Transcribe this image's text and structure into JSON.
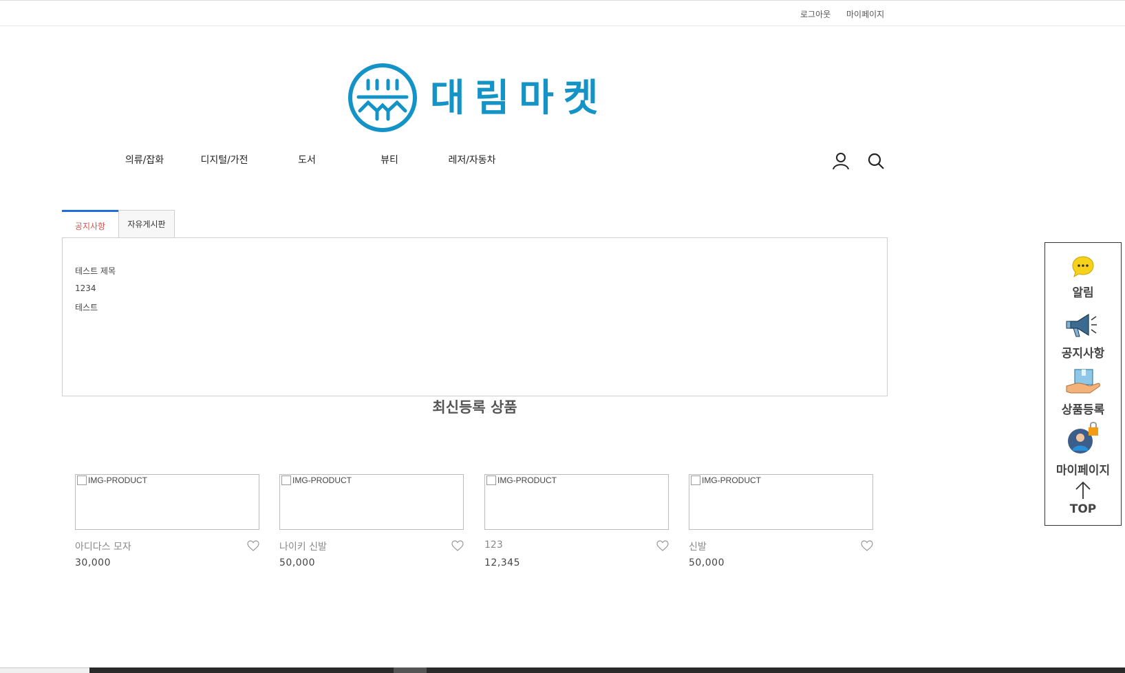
{
  "topbar": {
    "logout": "로그아웃",
    "mypage": "마이페이지"
  },
  "logo": {
    "text": "대림마켓",
    "color": "#1493c7"
  },
  "gnb": [
    "의류/잡화",
    "디지털/가전",
    "도서",
    "뷰티",
    "레저/자동차"
  ],
  "icons": {
    "user": "user-icon",
    "search": "search-icon"
  },
  "board": {
    "tabs": [
      "공지사항",
      "자유게시판"
    ],
    "posts": [
      "테스트 제목",
      "1234",
      "테스트"
    ]
  },
  "section": {
    "title": "최신등록 상품"
  },
  "products": [
    {
      "alt": "IMG-PRODUCT",
      "name": "아디다스 모자",
      "price": "30,000"
    },
    {
      "alt": "IMG-PRODUCT",
      "name": "나이키 신발",
      "price": "50,000"
    },
    {
      "alt": "IMG-PRODUCT",
      "name": "123",
      "price": "12,345"
    },
    {
      "alt": "IMG-PRODUCT",
      "name": "신발",
      "price": "50,000"
    }
  ],
  "quick": {
    "alarm": "알림",
    "notice": "공지사항",
    "register": "상품등록",
    "mypage": "마이페이지",
    "top": "TOP"
  }
}
